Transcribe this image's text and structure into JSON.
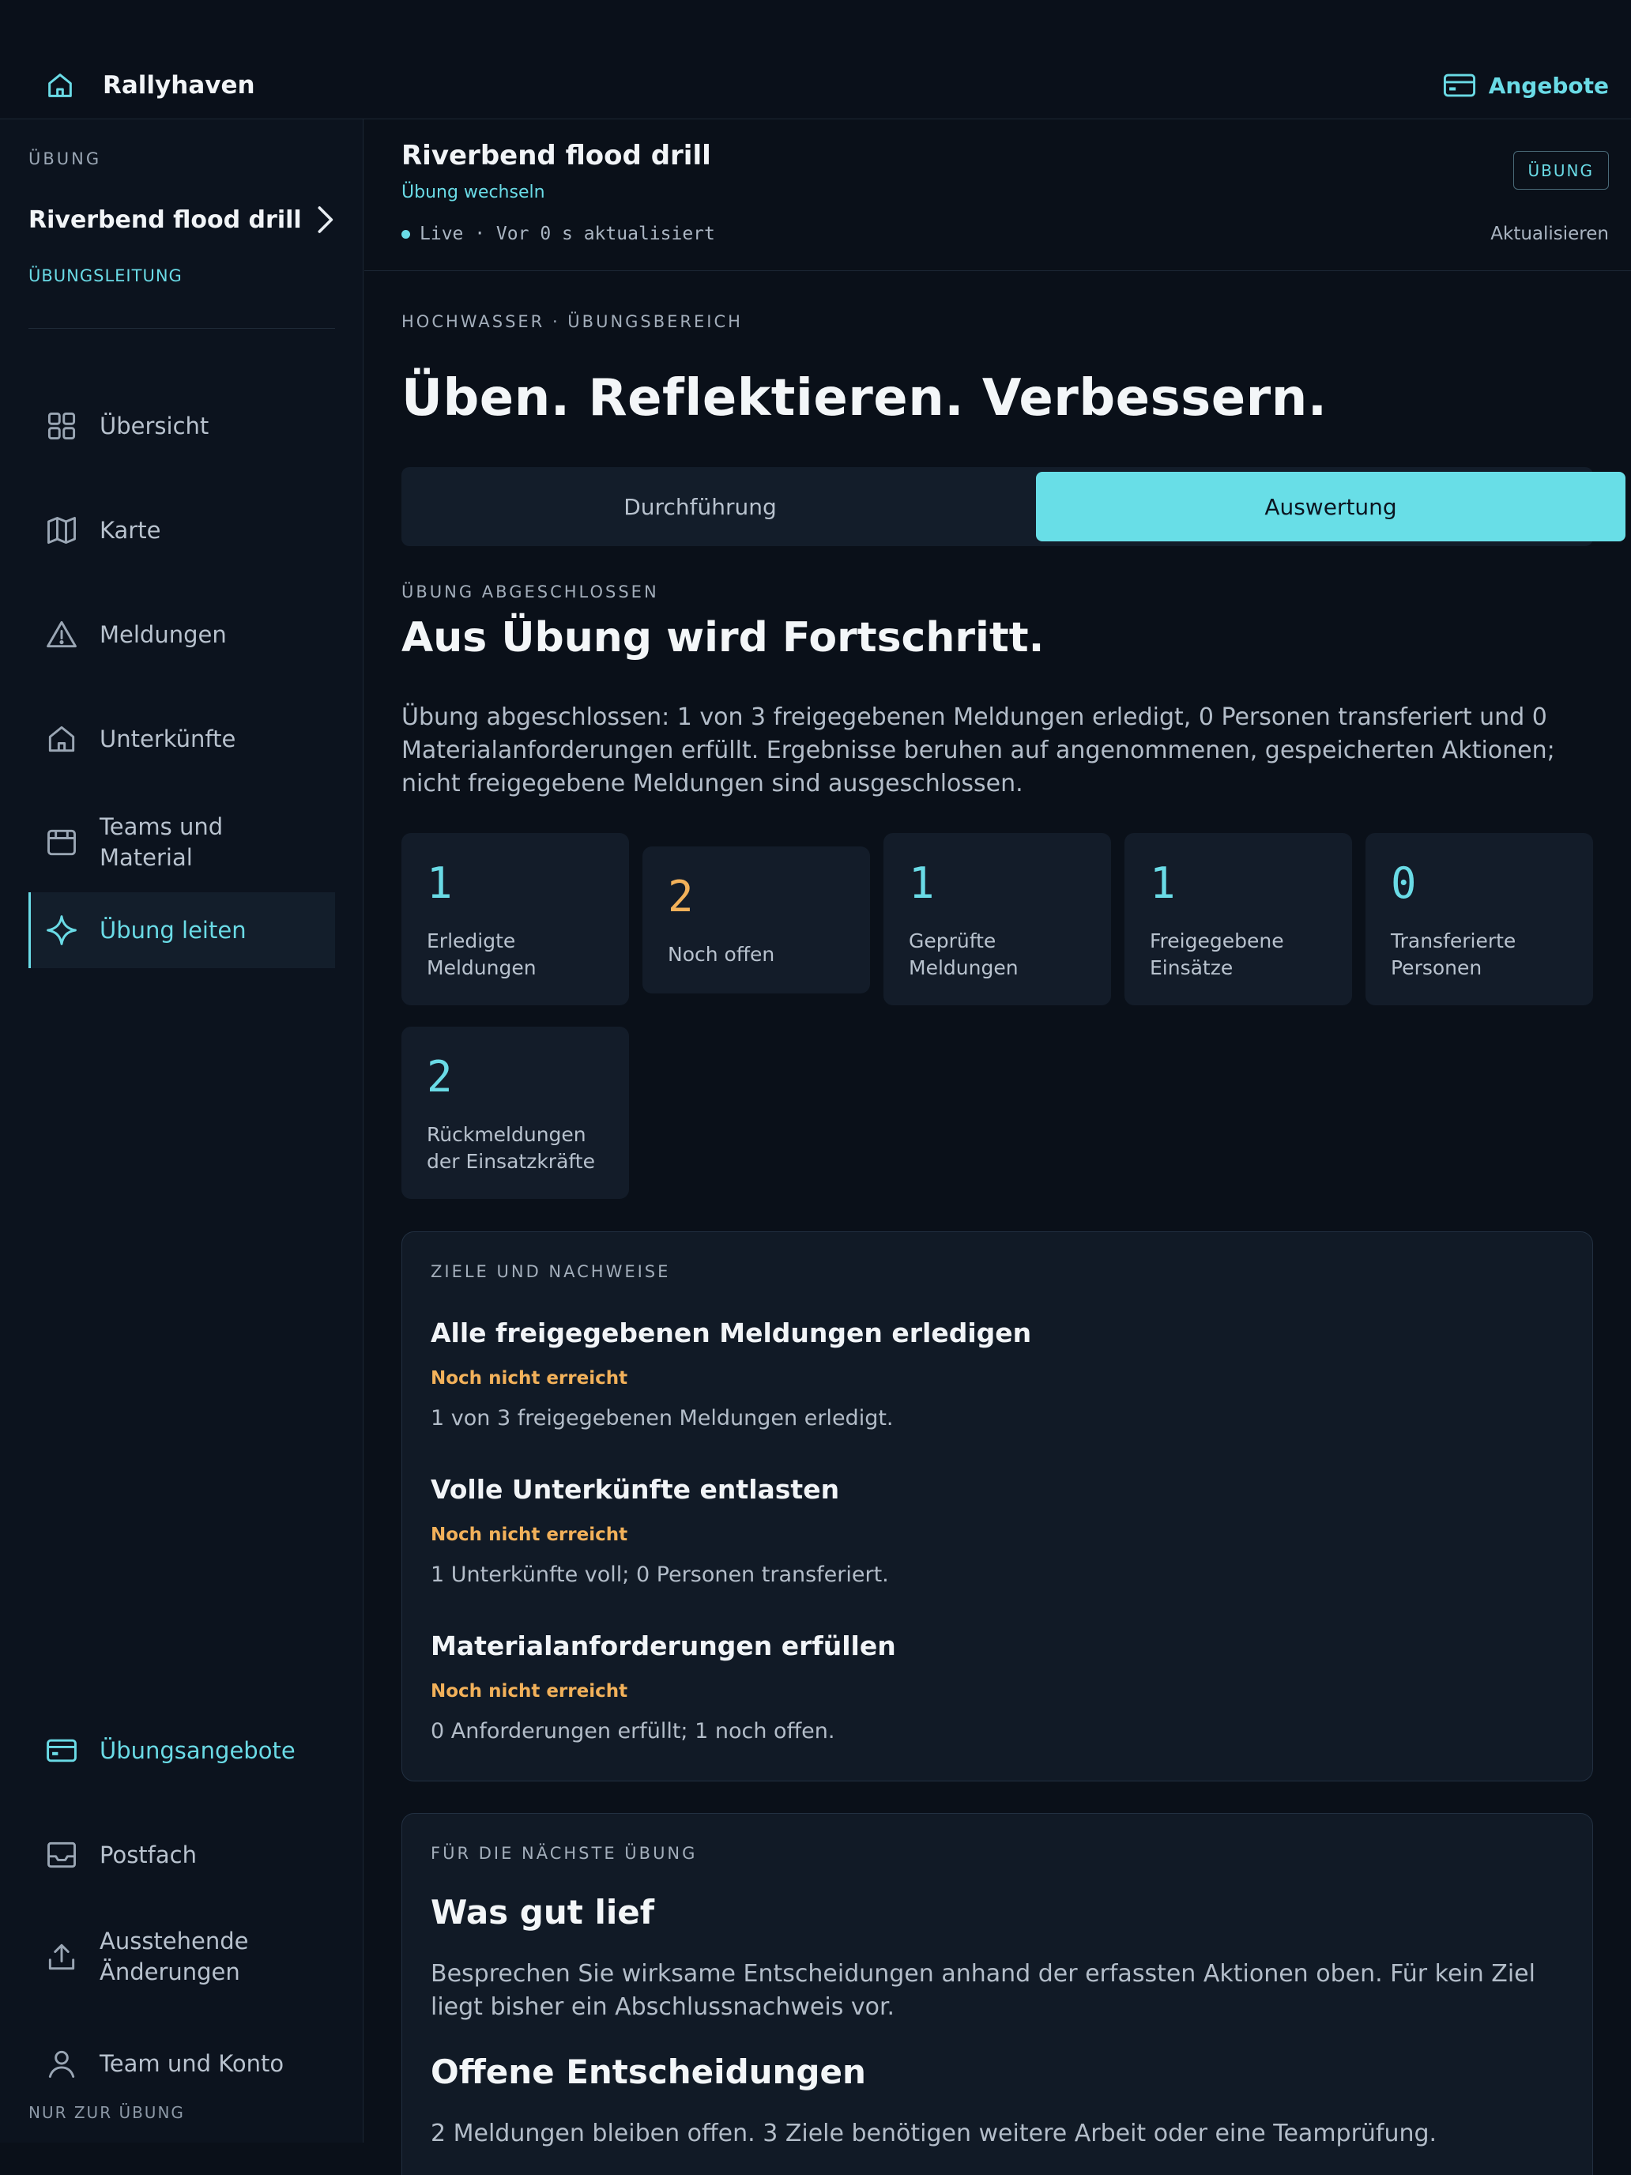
{
  "app": {
    "name": "Rallyhaven",
    "offers_label": "Angebote"
  },
  "sidebar": {
    "section_label": "ÜBUNG",
    "drill_name": "Riverbend flood drill",
    "role": "ÜBUNGSLEITUNG",
    "nav": [
      {
        "label": "Übersicht",
        "icon": "grid-icon"
      },
      {
        "label": "Karte",
        "icon": "map-icon"
      },
      {
        "label": "Meldungen",
        "icon": "warning-icon"
      },
      {
        "label": "Unterkünfte",
        "icon": "house-icon"
      },
      {
        "label": "Teams und Material",
        "icon": "kit-icon"
      },
      {
        "label": "Übung leiten",
        "icon": "sparkle-icon",
        "active": true
      }
    ],
    "bottom_nav": [
      {
        "label": "Übungsangebote",
        "icon": "card-icon"
      },
      {
        "label": "Postfach",
        "icon": "inbox-icon"
      },
      {
        "label": "Ausstehende Änderungen",
        "icon": "upload-icon"
      },
      {
        "label": "Team und Konto",
        "icon": "user-icon"
      }
    ],
    "footer": "NUR ZUR ÜBUNG"
  },
  "header": {
    "title": "Riverbend flood drill",
    "switch_label": "Übung wechseln",
    "status": "Live · Vor 0 s aktualisiert",
    "badge": "ÜBUNG",
    "refresh_label": "Aktualisieren"
  },
  "main": {
    "eyebrow": "HOCHWASSER · ÜBUNGSBEREICH",
    "hero": "Üben. Reflektieren. Verbessern.",
    "tabs": [
      {
        "label": "Durchführung",
        "selected": false
      },
      {
        "label": "Auswertung",
        "selected": true
      }
    ],
    "result_eyebrow": "ÜBUNG ABGESCHLOSSEN",
    "result_title": "Aus Übung wird Fortschritt.",
    "summary": "Übung abgeschlossen: 1 von 3 freigegebenen Meldungen erledigt, 0 Personen transferiert und 0 Materialanforderungen erfüllt. Ergebnisse beruhen auf angenommenen, gespeicherten Aktionen; nicht freigegebene Meldungen sind ausgeschlossen.",
    "stats": [
      {
        "value": "1",
        "label": "Erledigte Meldungen",
        "color": "#6adbe6"
      },
      {
        "value": "2",
        "label": "Noch offen",
        "color": "#f2b15a"
      },
      {
        "value": "1",
        "label": "Geprüfte Meldungen",
        "color": "#6adbe6"
      },
      {
        "value": "1",
        "label": "Freigegebene Einsätze",
        "color": "#6adbe6"
      },
      {
        "value": "0",
        "label": "Transferierte Personen",
        "color": "#6adbe6"
      },
      {
        "value": "2",
        "label": "Rückmeldungen der Einsatzkräfte",
        "color": "#6adbe6"
      }
    ],
    "goals": {
      "eyebrow": "ZIELE UND NACHWEISE",
      "items": [
        {
          "title": "Alle freigegebenen Meldungen erledigen",
          "status": "Noch nicht erreicht",
          "detail": "1 von 3 freigegebenen Meldungen erledigt."
        },
        {
          "title": "Volle Unterkünfte entlasten",
          "status": "Noch nicht erreicht",
          "detail": "1 Unterkünfte voll; 0 Personen transferiert."
        },
        {
          "title": "Materialanforderungen erfüllen",
          "status": "Noch nicht erreicht",
          "detail": "0 Anforderungen erfüllt; 1 noch offen."
        }
      ]
    },
    "next": {
      "eyebrow": "FÜR DIE NÄCHSTE ÜBUNG",
      "went_well_title": "Was gut lief",
      "went_well_text": "Besprechen Sie wirksame Entscheidungen anhand der erfassten Aktionen oben. Für kein Ziel liegt bisher ein Abschlussnachweis vor.",
      "open_title": "Offene Entscheidungen",
      "open_text": "2 Meldungen bleiben offen. 3 Ziele benötigen weitere Arbeit oder eine Teamprüfung."
    }
  },
  "colors": {
    "accent": "#6adbe6",
    "warning": "#f2b15a",
    "background": "#0a1019",
    "surface": "#131c29"
  }
}
